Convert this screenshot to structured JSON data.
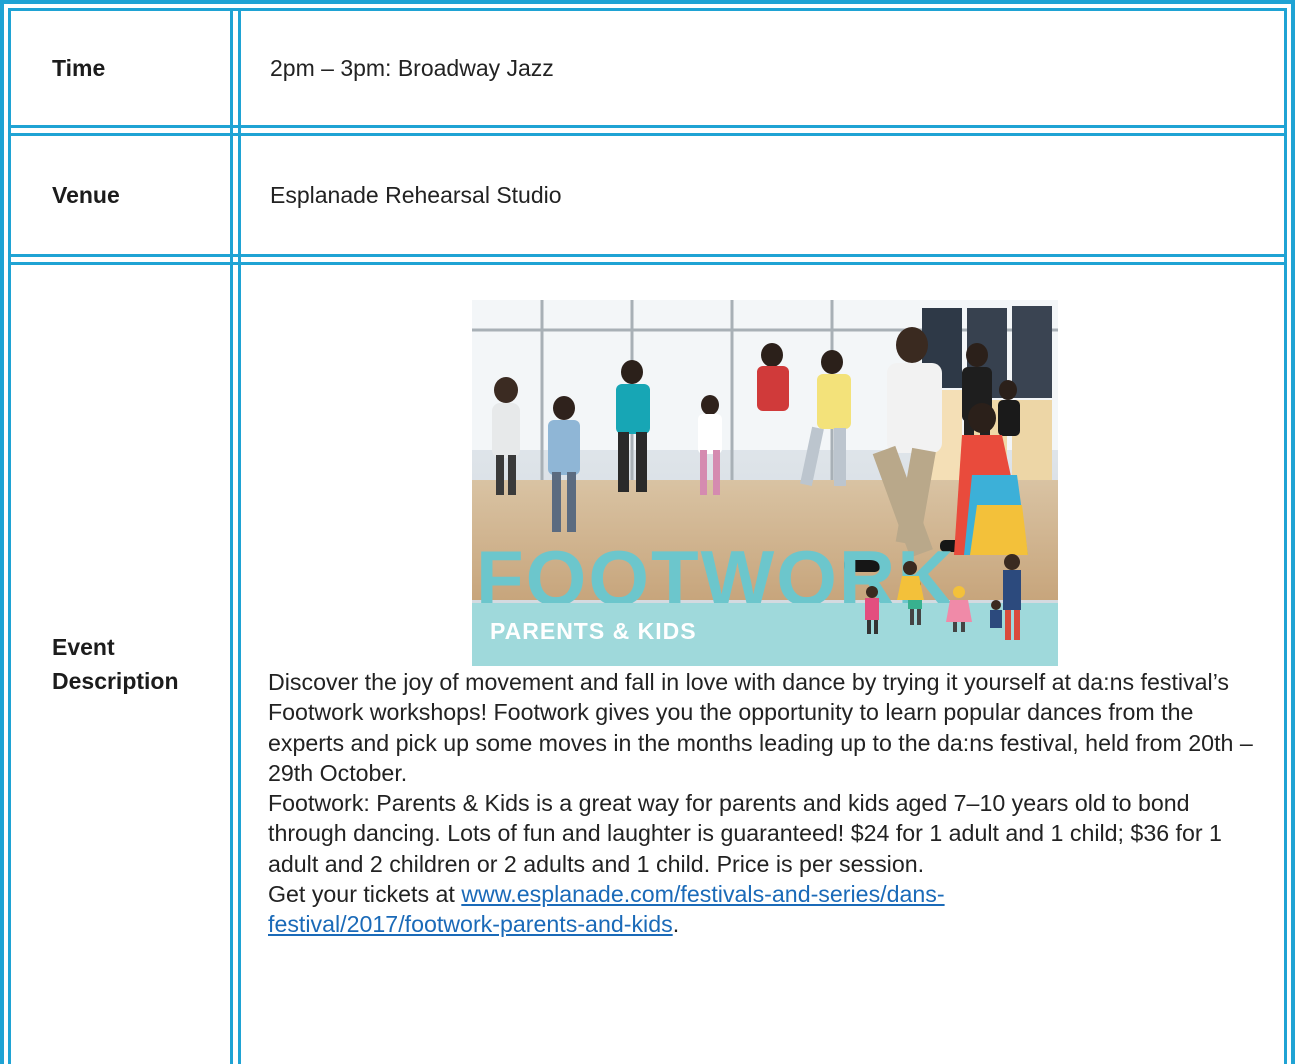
{
  "rows": {
    "time": {
      "label": "Time",
      "value": "2pm – 3pm: Broadway Jazz"
    },
    "venue": {
      "label": "Venue",
      "value": "Esplanade Rehearsal Studio"
    },
    "description": {
      "label_line1": "Event",
      "label_line2": "Description",
      "image": {
        "title": "FOOTWORK",
        "subtitle": "PARENTS & KIDS"
      },
      "para1": "Discover the joy of movement and fall in love with dance by trying it yourself at da:ns festival’s Footwork workshops! Footwork gives you the opportunity to learn popular dances from the experts and pick up some moves in the months leading up to the da:ns festival, held from 20th – 29th October.",
      "para2": "Footwork: Parents & Kids is a great way for parents and kids aged 7–10 years old to bond through dancing. Lots of fun and laughter is guaranteed! $24 for 1 adult and 1 child; $36 for 1 adult and 2 children or 2 adults and 1 child. Price is per session.",
      "tickets_prefix": "Get your tickets at ",
      "tickets_link_line1": "www.esplanade.com/festivals-and-series/dans-",
      "tickets_link_line2": "festival/2017/footwork-parents-and-kids",
      "tickets_suffix": "."
    }
  },
  "colors": {
    "border": "#1fa3d4",
    "link": "#1a6ab8",
    "banner_teal": "#9fd9db",
    "title_teal": "#6cc6cc"
  }
}
